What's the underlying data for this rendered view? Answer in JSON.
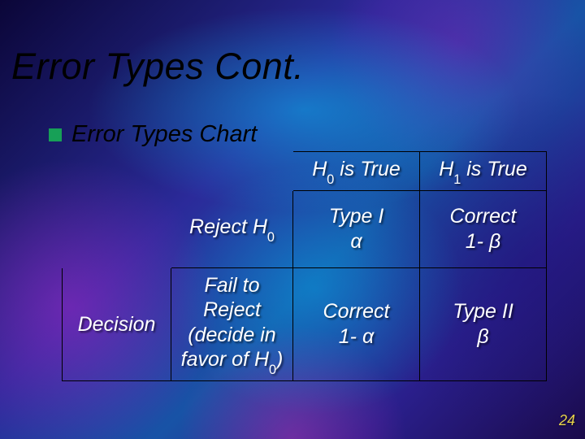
{
  "slide": {
    "title": "Error Types Cont.",
    "subtitle": "Error Types Chart",
    "page_number": "24"
  },
  "table": {
    "col_headers": {
      "h0": "H",
      "h0_sub": "0",
      "h0_tail": " is True",
      "h1": "H",
      "h1_sub": "1",
      "h1_tail": " is True"
    },
    "decision_label": "Decision",
    "rows": {
      "reject": {
        "label_pre": "Reject H",
        "label_sub": "0",
        "h0_true_line1": "Type I",
        "h0_true_line2": "α",
        "h1_true_line1": "Correct",
        "h1_true_line2": "1- β"
      },
      "fail": {
        "label_l1": "Fail to",
        "label_l2": "Reject",
        "label_l3": "(decide in",
        "label_l4_pre": "favor of H",
        "label_l4_sub": "0",
        "label_l4_post": ")",
        "h0_true_line1": "Correct",
        "h0_true_line2": "1- α",
        "h1_true_line1": "Type II",
        "h1_true_line2": "β"
      }
    }
  }
}
